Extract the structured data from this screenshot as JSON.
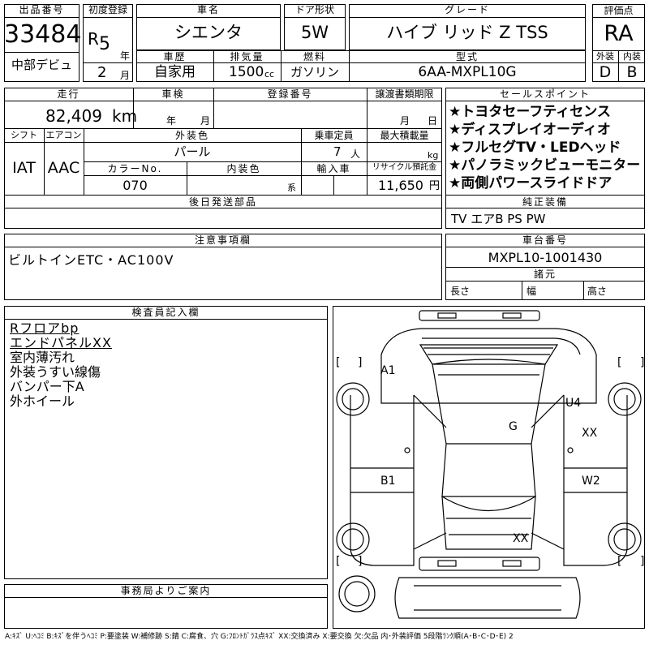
{
  "header": {
    "lot_label": "出品番号",
    "lot_number": "33484",
    "first_reg_label": "初度登録",
    "era": "R",
    "year": "5",
    "year_unit": "年",
    "month": "2",
    "month_unit": "月",
    "name_label": "車名",
    "name": "シエンタ",
    "door_label": "ドア形状",
    "door": "5W",
    "grade_label": "グレード",
    "grade": "ハイブ リッド Z TSS",
    "score_label": "評価点",
    "score": "RA",
    "venue": "中部デビュ",
    "history_label": "車歴",
    "history": "自家用",
    "displacement_label": "排気量",
    "displacement": "1500",
    "displacement_unit": "cc",
    "fuel_label": "燃料",
    "fuel": "ガソリン",
    "model_label": "型式",
    "model": "6AA-MXPL10G",
    "exterior_label": "外装",
    "exterior_grade": "D",
    "interior_label": "内装",
    "interior_grade": "B"
  },
  "row2": {
    "mileage_label": "走行",
    "mileage": "82,409",
    "mileage_unit": "km",
    "inspection_label": "車検",
    "insp_year_unit": "年",
    "insp_month_unit": "月",
    "regno_label": "登録番号",
    "transfer_label": "譲渡書類期限",
    "transfer_month_unit": "月",
    "transfer_day_unit": "日",
    "shift_label": "シフト",
    "shift": "IAT",
    "ac_label": "エアコン",
    "ac": "AAC",
    "color_label": "外装色",
    "color": "パール",
    "capacity_label": "乗車定員",
    "capacity": "7",
    "capacity_unit": "人",
    "load_label": "最大積載量",
    "load_unit": "kg",
    "color_no_label": "カラーNo.",
    "color_no": "070",
    "int_color_label": "内装色",
    "int_color_unit": "系",
    "import_label": "輸入車",
    "recycle_label": "リサイクル預託金",
    "recycle": "11,650",
    "recycle_unit": "円",
    "later_parts_label": "後日発送部品"
  },
  "sales_points": {
    "label": "セールスポイント",
    "items": [
      "★トヨタセーフティセンス",
      "★ディスプレイオーディオ",
      "★フルセグTV・LEDヘッド",
      "★パノラミックビューモニター",
      "★両側パワースライドドア"
    ]
  },
  "equipment": {
    "label": "純正装備",
    "value": "TV エアB PS PW"
  },
  "notes": {
    "label": "注意事項欄",
    "value": "ビルトインETC・AC100V"
  },
  "chassis": {
    "label": "車台番号",
    "value": "MXPL10-1001430",
    "spec_label": "諸元",
    "length_label": "長さ",
    "width_label": "幅",
    "height_label": "高さ"
  },
  "inspector": {
    "label": "検査員記入欄",
    "lines": [
      "Rフロアbp",
      "エンドパネルXX",
      "室内薄汚れ",
      "外装うすい線傷",
      "バンパー下A",
      "外ホイール"
    ]
  },
  "diagram": {
    "marks": [
      "A1",
      "U4",
      "G",
      "XX",
      "B1",
      "W2",
      "XX"
    ],
    "bracket_open": "[",
    "bracket_close": "]"
  },
  "office": {
    "label": "事務局よりご案内"
  },
  "legend": "A:ｷｽﾞ U:ﾍｺﾐ B:ｷｽﾞを伴うﾍｺﾐ P:要塗装 W:補修跡 S:錆 C:腐食、穴 G:ﾌﾛﾝﾄｶﾞﾗｽ点ｷｽﾞ XX:交換済み X:要交換 欠:欠品 内･外装評価 5段階ﾗﾝｸ順(A･B･C･D･E) 2"
}
